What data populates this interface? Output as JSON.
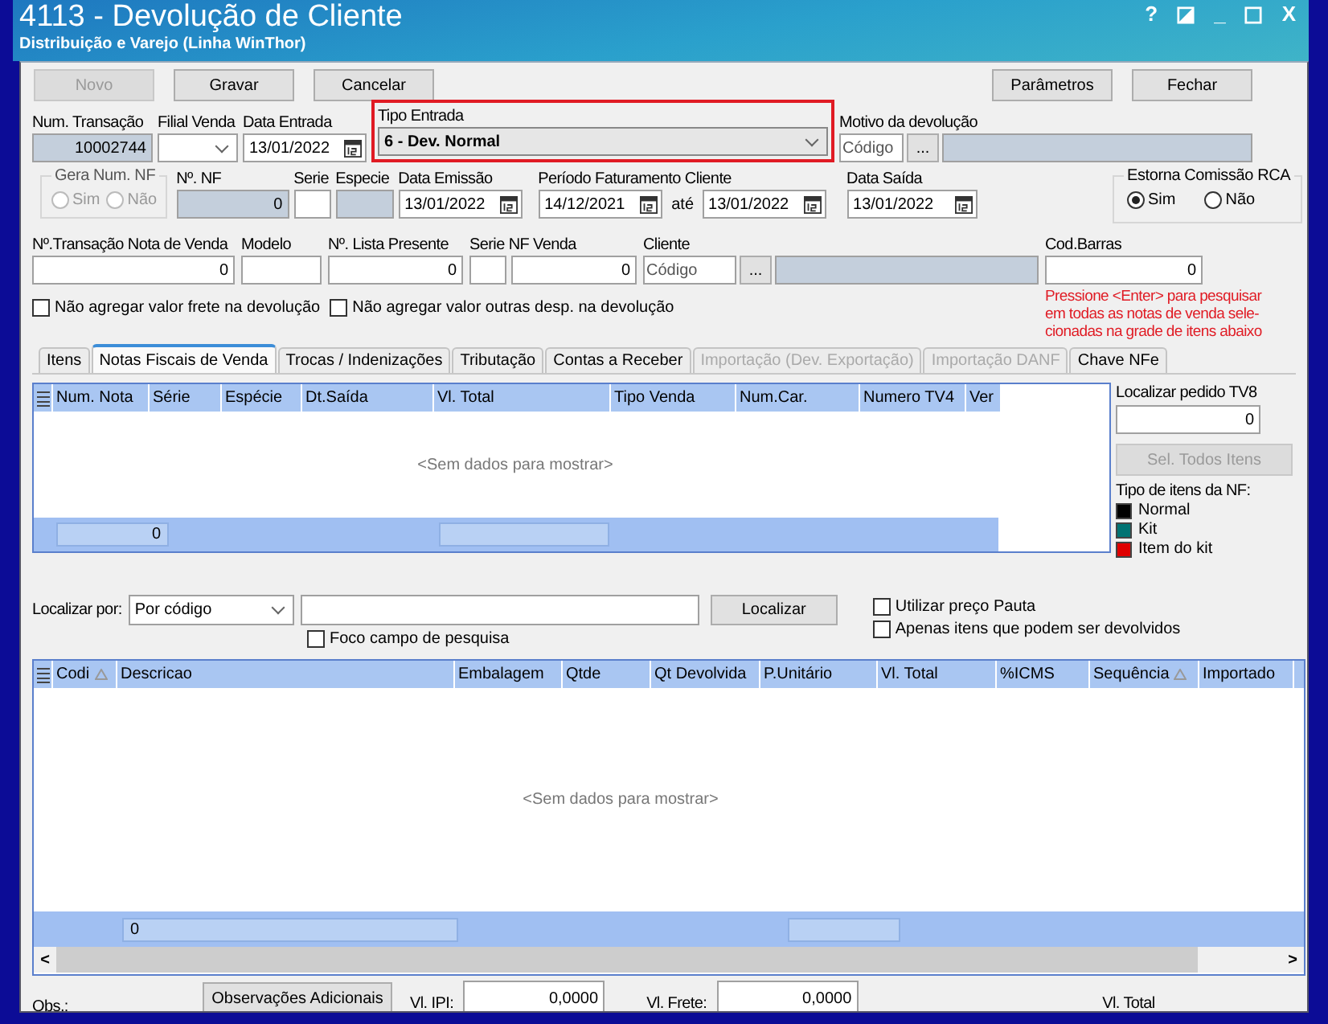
{
  "window": {
    "title": "4113 - Devolução de Cliente",
    "subtitle": "Distribuição e Varejo (Linha WinThor)",
    "controls": [
      {
        "kind": "text",
        "text": "?"
      },
      {
        "kind": "theme"
      },
      {
        "kind": "text",
        "text": "_"
      },
      {
        "kind": "maximize"
      },
      {
        "kind": "text",
        "text": "X"
      }
    ]
  },
  "toolbar": {
    "left": [
      {
        "label": "Novo",
        "disabled": true
      },
      {
        "label": "Gravar",
        "disabled": false
      },
      {
        "label": "Cancelar",
        "disabled": false
      }
    ],
    "right": [
      {
        "label": "Parâmetros",
        "disabled": false
      },
      {
        "label": "Fechar",
        "disabled": false
      }
    ]
  },
  "num_transacao": {
    "label": "Num. Transação",
    "value": "10002744"
  },
  "filial_venda": {
    "label": "Filial Venda"
  },
  "data_entrada": {
    "label": "Data Entrada",
    "value": "13/01/2022"
  },
  "tipo_entrada": {
    "label": "Tipo Entrada",
    "value": "6 - Dev. Normal",
    "highlighted": true
  },
  "motivo": {
    "label": "Motivo da devolução",
    "placeholder": "Código",
    "button": "..."
  },
  "gera_num_nf": {
    "label": "Gera Num. NF",
    "disabled": true,
    "options": [
      {
        "label": "Sim",
        "selected": false
      },
      {
        "label": "Não",
        "selected": false
      }
    ]
  },
  "num_nf": {
    "label": "Nº. NF",
    "value": "0"
  },
  "serie": {
    "label": "Serie"
  },
  "especie": {
    "label": "Especie"
  },
  "data_emissao": {
    "label": "Data Emissão",
    "value": "13/01/2022"
  },
  "periodo": {
    "label": "Período Faturamento Cliente",
    "from": "14/12/2021",
    "separator": "até",
    "to": "13/01/2022"
  },
  "data_saida": {
    "label": "Data Saída",
    "value": "13/01/2022"
  },
  "estorna": {
    "label": "Estorna Comissão RCA",
    "disabled": false,
    "options": [
      {
        "label": "Sim",
        "selected": true
      },
      {
        "label": "Não",
        "selected": false
      }
    ]
  },
  "transacao_nota": {
    "label": "Nº.Transação Nota de Venda",
    "value": "0"
  },
  "modelo": {
    "label": "Modelo"
  },
  "lista_presente": {
    "label": "Nº. Lista Presente",
    "value": "0"
  },
  "serie_nf_venda": {
    "label": "Serie NF Venda",
    "value": "0"
  },
  "cliente": {
    "label": "Cliente",
    "placeholder": "Código",
    "button": "..."
  },
  "cod_barras": {
    "label": "Cod.Barras",
    "value": "0",
    "hint_lines": [
      "Pressione <Enter> para pesquisar",
      "em todas as notas de venda sele-",
      "cionadas na grade de itens abaixo"
    ]
  },
  "options_checks": [
    {
      "label": "Não agregar valor frete  na devolução",
      "checked": false
    },
    {
      "label": "Não agregar valor outras desp. na devolução",
      "checked": false
    }
  ],
  "tabs": [
    {
      "label": "Itens",
      "selected": false,
      "disabled": false
    },
    {
      "label": "Notas Fiscais de Venda",
      "selected": true,
      "disabled": false
    },
    {
      "label": "Trocas / Indenizações",
      "selected": false,
      "disabled": false
    },
    {
      "label": "Tributação",
      "selected": false,
      "disabled": false
    },
    {
      "label": "Contas a Receber",
      "selected": false,
      "disabled": false
    },
    {
      "label": "Importação (Dev. Exportação)",
      "selected": false,
      "disabled": true
    },
    {
      "label": "Importação DANF",
      "selected": false,
      "disabled": true
    },
    {
      "label": "Chave NFe",
      "selected": false,
      "disabled": false
    }
  ],
  "notes_grid": {
    "columns": [
      "Num. Nota",
      "Série",
      "Espécie",
      "Dt.Saída",
      "Vl. Total",
      "Tipo Venda",
      "Num.Car.",
      "Numero TV4",
      "Ver"
    ],
    "empty_text": "<Sem dados para mostrar>",
    "footer_value": "0"
  },
  "tv8": {
    "label": "Localizar pedido TV8",
    "value": "0",
    "button": {
      "label": "Sel. Todos Itens",
      "disabled": true
    }
  },
  "legend": {
    "title": "Tipo de itens da NF:",
    "items": [
      {
        "label": "Normal",
        "color": "#000000"
      },
      {
        "label": "Kit",
        "color": "#007373"
      },
      {
        "label": "Item do kit",
        "color": "#e00000"
      }
    ]
  },
  "search": {
    "label": "Localizar por:",
    "mode": "Por código",
    "button": "Localizar",
    "focus_check": {
      "label": "Foco campo de pesquisa",
      "checked": false
    }
  },
  "item_filters": [
    {
      "label": "Utilizar preço Pauta",
      "checked": false
    },
    {
      "label": "Apenas itens que podem ser devolvidos",
      "checked": false
    }
  ],
  "items_grid": {
    "columns": [
      {
        "label": "Codi",
        "sorted": true
      },
      {
        "label": "Descricao",
        "sorted": false
      },
      {
        "label": "Embalagem",
        "sorted": false
      },
      {
        "label": "Qtde",
        "sorted": false
      },
      {
        "label": "Qt Devolvida",
        "sorted": false
      },
      {
        "label": "P.Unitário",
        "sorted": false
      },
      {
        "label": "Vl. Total",
        "sorted": false
      },
      {
        "label": "%ICMS",
        "sorted": false
      },
      {
        "label": "Sequência",
        "sorted": true
      },
      {
        "label": "Importado",
        "sorted": false
      }
    ],
    "empty_text": "<Sem dados para mostrar>",
    "footer_value": "0",
    "scroll_left": "<",
    "scroll_right": ">"
  },
  "footer": {
    "obs_label": "Obs.:",
    "obs_button": "Observações Adicionais",
    "ipi": {
      "label": "Vl. IPI:",
      "value": "0,0000"
    },
    "frete": {
      "label": "Vl. Frete:",
      "value": "0,0000"
    },
    "total_label": "Vl. Total"
  }
}
